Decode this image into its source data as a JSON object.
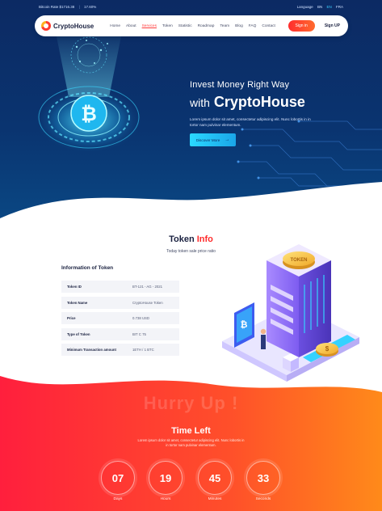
{
  "topbar": {
    "bitcoin_rate": "Bitcoin Rate $1716.38",
    "change": "17.60%",
    "language_label": "Language",
    "languages": [
      "BN",
      "EN",
      "FRA"
    ]
  },
  "nav": {
    "brand": "CryptoHouse",
    "items": [
      "Home",
      "About",
      "Services",
      "Token",
      "Statistic",
      "Roadmap",
      "Team",
      "Blog",
      "FAQ",
      "Contact"
    ],
    "active": "Services",
    "signin": "Sign in",
    "signup": "Sign UP"
  },
  "hero": {
    "title_line1": "Invest Money Right Way",
    "title_with": "with",
    "title_brand": "CryptoHouse",
    "description": "Lorem ipsum dolor sit amet, consectetur adipiscing elit. Nunc lobortis in in tortor nam pulvinar elementum.",
    "cta": "Discover More",
    "cta_arrow": "→"
  },
  "token": {
    "title_main": "Token",
    "title_accent": "Info",
    "subtitle": "Today token sale price ratio",
    "info_heading": "Information of Token",
    "rows": [
      {
        "key": "Token ID",
        "value": "BT-121 - AG - 2021"
      },
      {
        "key": "Token Name",
        "value": "CryptoHouse Token"
      },
      {
        "key": "Price",
        "value": "0.738 USD"
      },
      {
        "key": "Type of Token",
        "value": "BIT C 75"
      },
      {
        "key": "Minimum Transaction amount",
        "value": "1ETH / 1 BTC"
      }
    ]
  },
  "countdown": {
    "watermark": "Hurry Up !",
    "title": "Time Left",
    "description": "Lorem ipsum dolor sit amet, consectetur adipiscing elit. Nunc lobortis in in tortor nam pulvinar elementum.",
    "units": [
      {
        "value": "07",
        "label": "Days"
      },
      {
        "value": "19",
        "label": "Hours"
      },
      {
        "value": "45",
        "label": "Minutes"
      },
      {
        "value": "33",
        "label": "Seconds"
      }
    ]
  },
  "colors": {
    "accent_red": "#ff2b2b",
    "accent_cyan": "#2ad9ff",
    "hero_navy": "#0c2a63",
    "countdown_orange": "#ff7a1a"
  },
  "icons": [
    "logo-icon",
    "bitcoin-hologram-icon",
    "arrow-right-icon",
    "circuit-lines-icon",
    "crypto-building-illustration"
  ]
}
